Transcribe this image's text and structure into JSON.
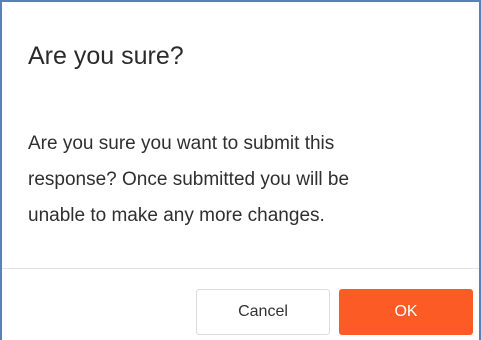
{
  "dialog": {
    "title": "Are you sure?",
    "message_lines": [
      "Are you sure you want to submit this",
      "response? Once submitted you will be",
      "unable to make any more changes."
    ],
    "buttons": {
      "cancel_label": "Cancel",
      "ok_label": "OK"
    }
  },
  "colors": {
    "ok_button": "#fd5b25",
    "frame_border": "#5b7fb8"
  }
}
